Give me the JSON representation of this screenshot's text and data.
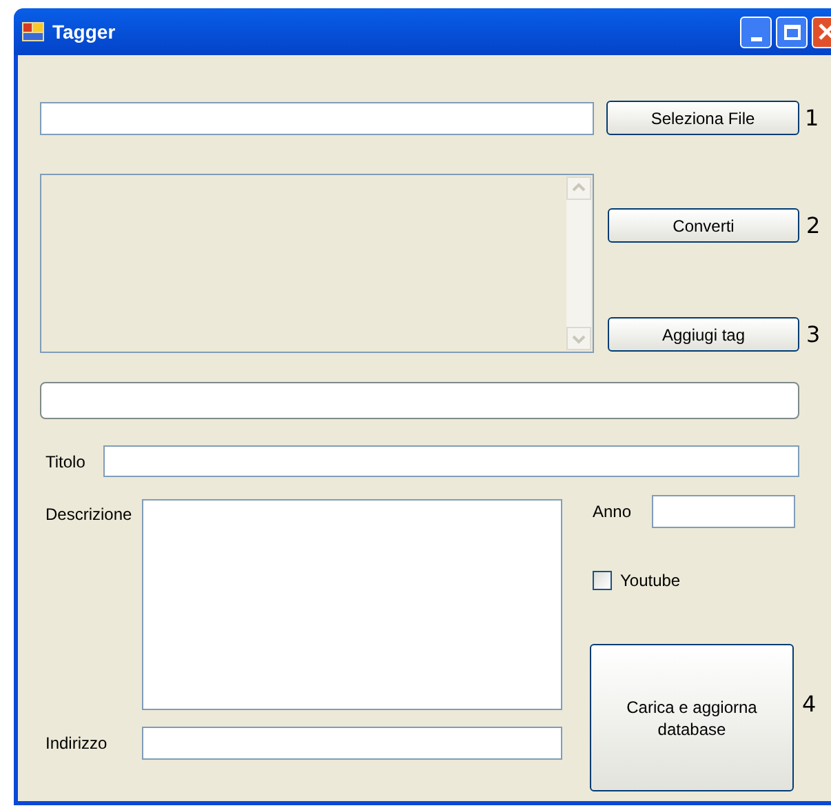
{
  "window": {
    "title": "Tagger"
  },
  "select_file_button": {
    "label": "Seleziona File",
    "step": "1"
  },
  "output_box": {
    "disabled": true
  },
  "convert_button": {
    "label": "Converti",
    "step": "2"
  },
  "add_tag_button": {
    "label": "Aggiugi tag",
    "step": "3"
  },
  "labels": {
    "title": "Titolo",
    "description": "Descrizione",
    "address": "Indirizzo",
    "year": "Anno"
  },
  "youtube": {
    "label": "Youtube",
    "checked": false
  },
  "upload_button": {
    "label": "Carica e aggiorna database",
    "step": "4"
  }
}
